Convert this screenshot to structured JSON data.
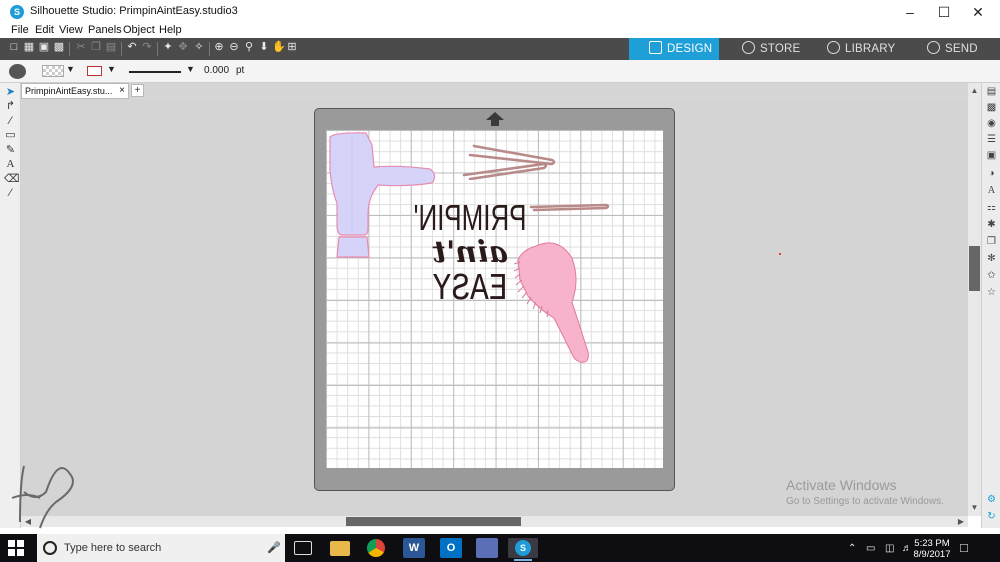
{
  "window": {
    "title": "Silhouette Studio: PrimpinAintEasy.studio3",
    "app_icon": "S",
    "controls": [
      "minimize-icon",
      "maximize-icon",
      "close-icon"
    ]
  },
  "menu": [
    "File",
    "Edit",
    "View",
    "Panels",
    "Object",
    "Help"
  ],
  "nav_tabs": [
    {
      "label": "DESIGN",
      "icon": "design-grid-icon",
      "active": true
    },
    {
      "label": "STORE",
      "icon": "store-icon",
      "active": false
    },
    {
      "label": "LIBRARY",
      "icon": "cloud-library-icon",
      "active": false
    },
    {
      "label": "SEND",
      "icon": "send-check-icon",
      "active": false
    }
  ],
  "property_bar": {
    "line_width": "0.000",
    "unit": "pt"
  },
  "document_tab": {
    "label": "PrimpinAintEasy.stu...",
    "close": "×",
    "add": "+"
  },
  "design": {
    "line1": "PRIMPIN'",
    "line2": "ain't",
    "line3": "EASY"
  },
  "watermark": {
    "line1": "Activate Windows",
    "line2": "Go to Settings to activate Windows."
  },
  "taskbar": {
    "search_placeholder": "Type here to search",
    "time": "5:23 PM",
    "date": "8/9/2017",
    "apps": [
      "task-view-icon",
      "file-explorer-icon",
      "chrome-icon",
      "word-icon",
      "outlook-icon",
      "network-app-icon",
      "silhouette-studio-icon"
    ]
  },
  "colors": {
    "accent": "#1f9fd7",
    "toolbar": "#4b4b4b",
    "mat": "#9a9a9a",
    "hairdryer": "#d6d3f8",
    "brush": "#f7b2cc",
    "bobby_pin": "#b98a8a"
  }
}
